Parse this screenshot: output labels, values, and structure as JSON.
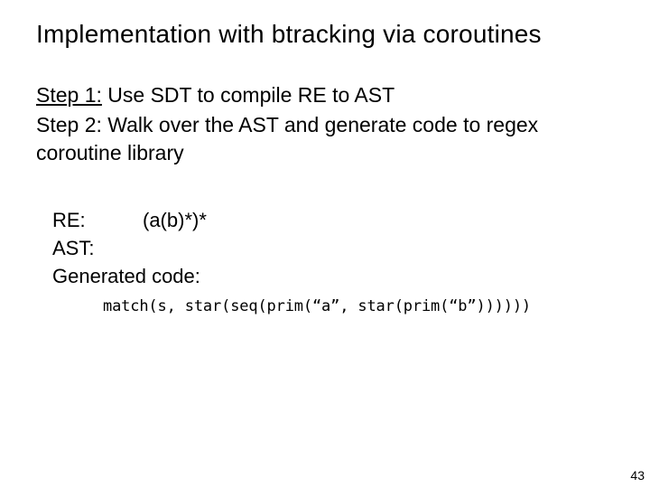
{
  "title": "Implementation with btracking via coroutines",
  "body": {
    "line1a": "Step 1:",
    "line1b": " Use SDT to compile RE to AST",
    "line2": "Step 2:  Walk over the AST and generate code to regex",
    "line3": "coroutine library"
  },
  "sub": {
    "re_label": "RE:",
    "re_value": "(a(b)*)*",
    "ast_label": "AST:",
    "gen_label": "Generated code:"
  },
  "code": "match(s, star(seq(prim(“a”,  star(prim(“b”))))))",
  "page_number": "43"
}
